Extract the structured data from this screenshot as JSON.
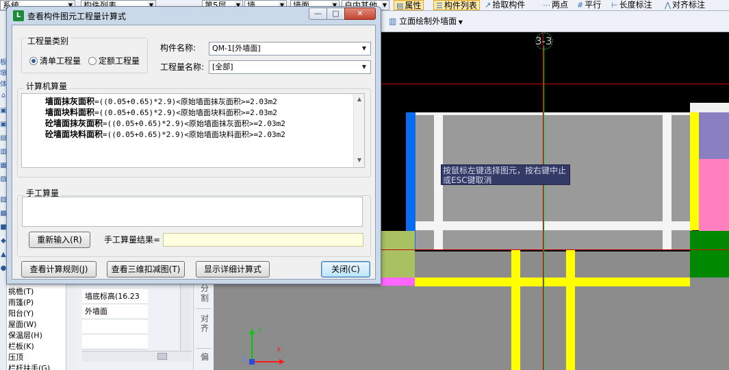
{
  "topbar": {
    "combo1": "系统",
    "combo2": "构件列表",
    "floor": "第5层",
    "category": "墙",
    "wall_kind": "墙面",
    "element": "户内其他",
    "prop_button": "属性",
    "list_button": "构件列表",
    "pick_button": "拾取构件",
    "two_points": "两点",
    "parallel": "平行",
    "length_mark": "长度标注",
    "align_mark": "对齐标注"
  },
  "left_tree": {
    "items": [
      "挑檐(T)",
      "雨篷(P)",
      "阳台(Y)",
      "屋面(W)",
      "保温层(H)",
      "栏板(K)",
      "压顶",
      "栏杆扶手(G)"
    ]
  },
  "properties": {
    "rows": [
      "墙底标高(16.23",
      "外墙面",
      "",
      ""
    ]
  },
  "vertical_toolbar": {
    "split": "分割",
    "align": "对齐",
    "edit": "偏"
  },
  "bar2": {
    "elevation_button": "立面绘制外墙面"
  },
  "canvas": {
    "axis_label": "3-3",
    "tooltip": "按鼠标左键选择图元，按右键中止或ESC键取消",
    "axis_x_label": "X",
    "axis_y_label": "Y",
    "axis_z_label": "Z",
    "colors": {
      "yellow": "#ffff00",
      "green": "#008800",
      "pink": "#ff7fbf",
      "blue": "#0a6cf0",
      "purple": "#8a7fc0",
      "olive": "#a9c160",
      "magenta": "#ff66ff",
      "grid_red": "#cc0000"
    }
  },
  "dialog": {
    "title": "查看构件图元工程量计算式",
    "quantity_type_group": "工程量类别",
    "radio_bill": "清单工程量",
    "radio_quota": "定额工程量",
    "component_name_label": "构件名称:",
    "component_name_value": "QM-1[外墙面]",
    "quantity_name_label": "工程量名称:",
    "quantity_name_value": "[全部]",
    "computer_calc_group": "计算机算量",
    "calc_lines": [
      {
        "name": "墙面抹灰面积",
        "formula": "=((0.05+0.65)*2.9)<原始墙面抹灰面积>=2.03m2"
      },
      {
        "name": "墙面块料面积",
        "formula": "=((0.05+0.65)*2.9)<原始墙面块料面积>=2.03m2"
      },
      {
        "name": "砼墙面抹灰面积",
        "formula": "=((0.05+0.65)*2.9)<原始墙面抹灰面积>=2.03m2"
      },
      {
        "name": "砼墙面块料面积",
        "formula": "=((0.05+0.65)*2.9)<原始墙面块料面积>=2.03m2"
      }
    ],
    "manual_calc_group": "手工算量",
    "reinput_button": "重新输入(R)",
    "manual_result_label": "手工算量结果=",
    "rule_button": "查看计算规则(J)",
    "view3d_button": "查看三维扣减图(T)",
    "detail_button": "显示详细计算式",
    "close_button": "关闭(C)"
  }
}
